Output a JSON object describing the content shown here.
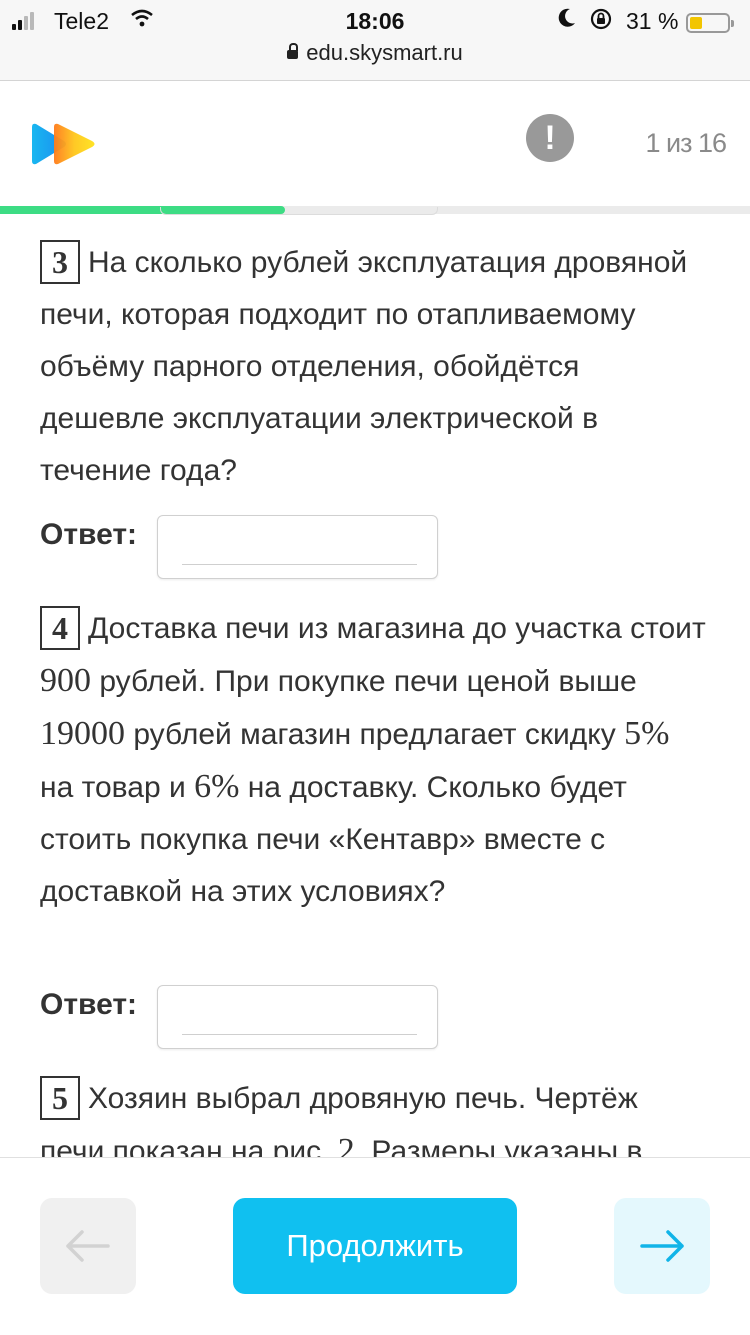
{
  "status_bar": {
    "carrier": "Tele2",
    "time": "18:06",
    "battery": "31 %",
    "url": "edu.skysmart.ru",
    "colors": {
      "battery_fill": "#f2c500"
    }
  },
  "header": {
    "counter": "1 из 16",
    "alert_icon": "!",
    "progress": 0.38,
    "colors": {
      "progress": "#3ddc84"
    }
  },
  "tasks": [
    {
      "number": "3",
      "text": "На сколько рублей эксплуатация дровяной печи, которая подходит по отапливаемому объёму парного отделения, обойдётся дешевле эксплуатации электрической в течение года?",
      "answer_label": "Ответ:",
      "answer_value": ""
    },
    {
      "number": "4",
      "text_parts": [
        "Доставка печи из магазина до участка стоит ",
        "900",
        " рублей. При покупке печи ценой выше ",
        "19000",
        " рублей магазин предлагает скидку ",
        "5%",
        " на товар и ",
        "6%",
        " на доставку. Сколько будет стоить покупка печи «Кентавр» вместе с доставкой на этих условиях?"
      ],
      "answer_label": "Ответ:",
      "answer_value": ""
    },
    {
      "number": "5",
      "text_parts": [
        "Хозяин выбрал дровяную печь. Чертёж печи показан на рис. ",
        "2",
        ". Размеры указаны в"
      ]
    }
  ],
  "footer": {
    "prev_icon": "←",
    "continue_label": "Продолжить",
    "next_icon": "→",
    "colors": {
      "continue": "#10c0f0",
      "next_bg": "#e4f8fd",
      "next_icon": "#10c0f0"
    }
  }
}
